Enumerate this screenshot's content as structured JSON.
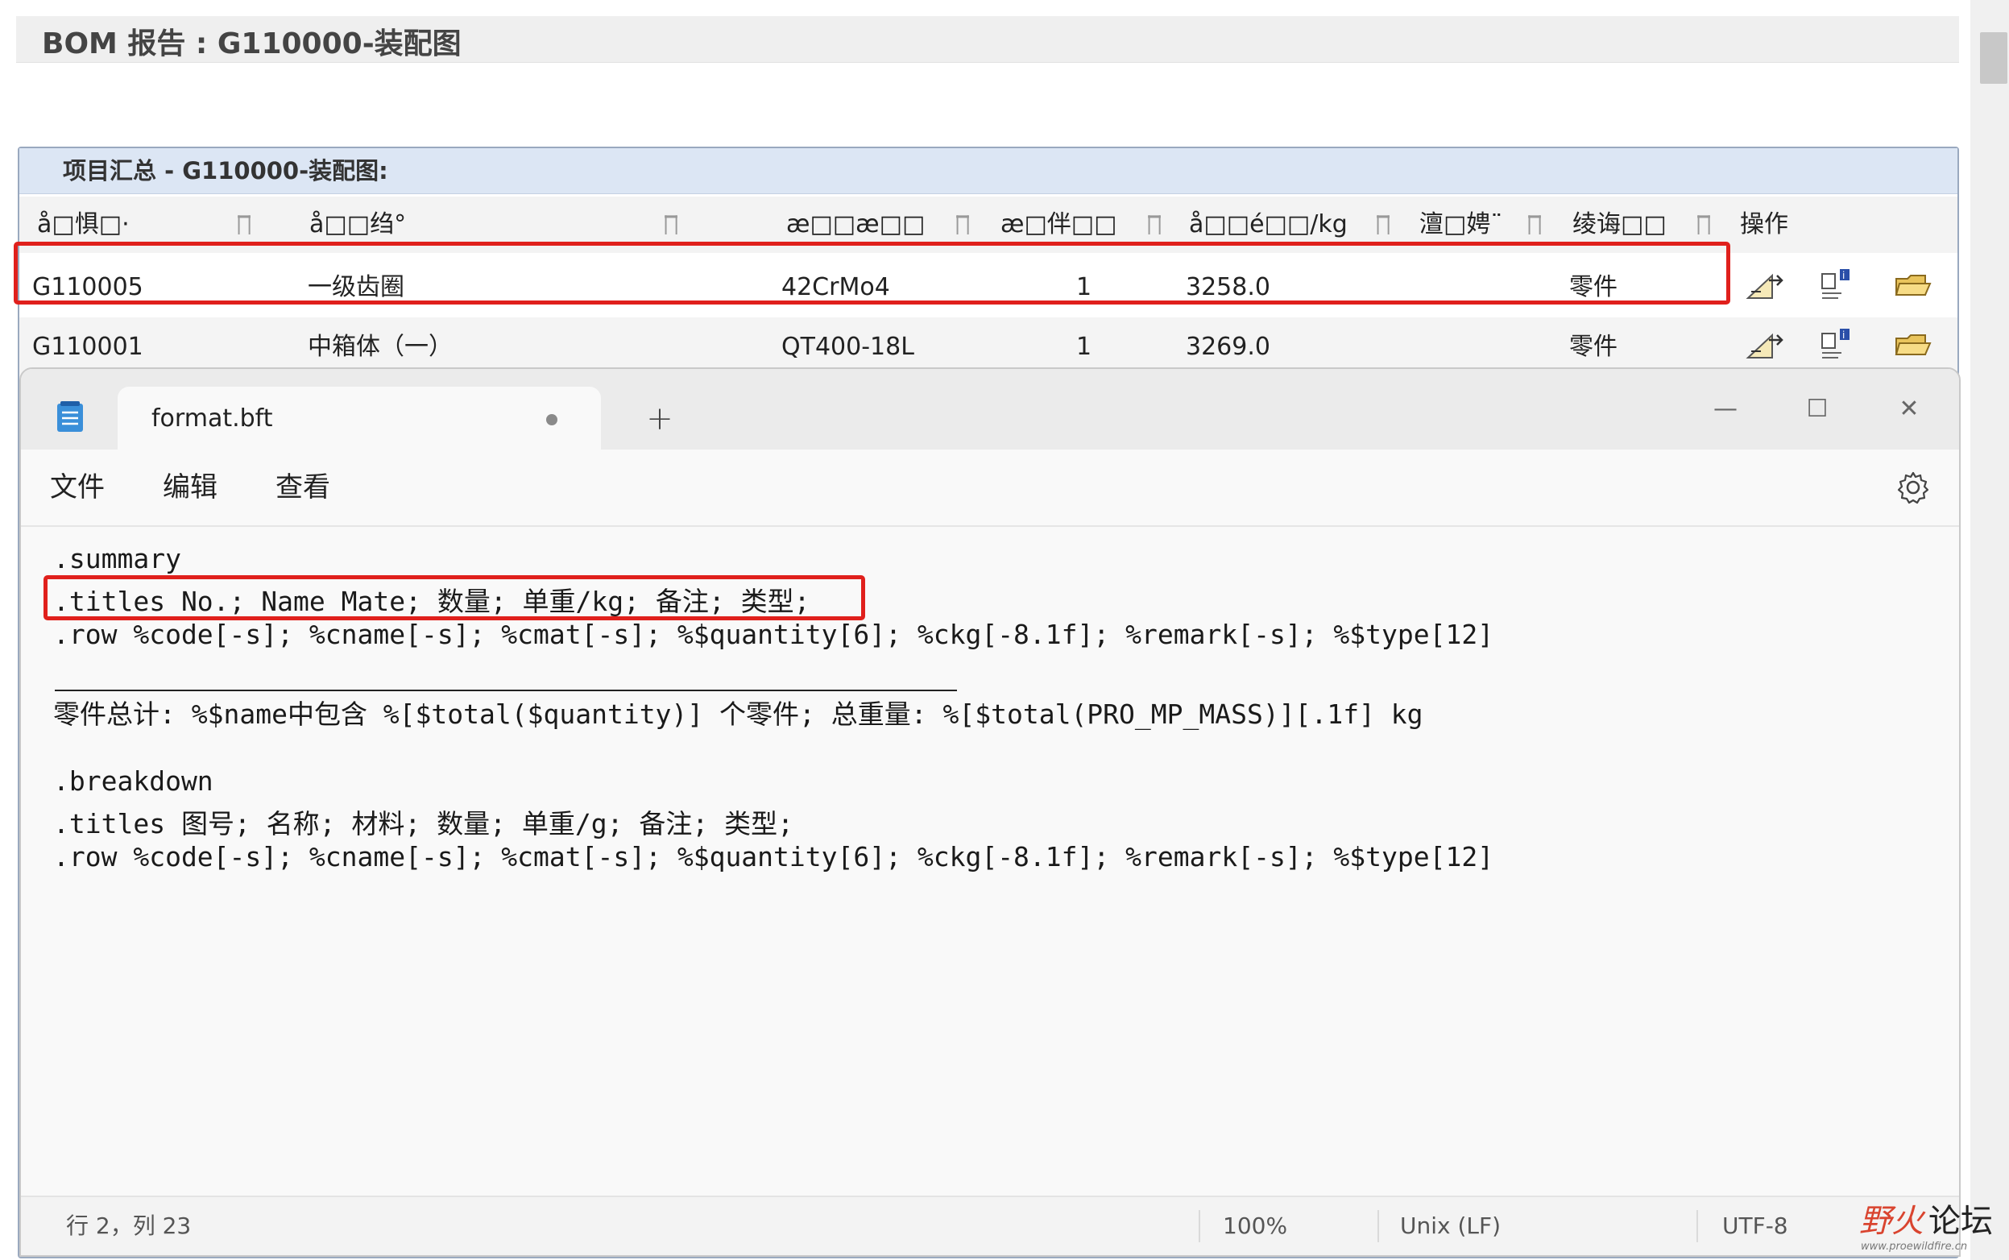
{
  "report": {
    "title": "BOM 报告 : G110000-装配图",
    "summary_title": "项目汇总 - G110000-装配图:",
    "columns": [
      "å□惧□·",
      "å□□绉°",
      "æ□□æ□□",
      "æ□伴□□",
      "å□□é□□/kg",
      "澶□娉¨",
      "绫诲□□",
      "操作"
    ],
    "rows": [
      {
        "code": "G110005",
        "name": "一级齿圈",
        "material": "42CrMo4",
        "qty": "1",
        "weight": "3258.0",
        "type": "零件"
      },
      {
        "code": "G110001",
        "name": "中箱体（一）",
        "material": "QT400-18L",
        "qty": "1",
        "weight": "3269.0",
        "type": "零件"
      }
    ],
    "action_icons": [
      "edit-dimension-icon",
      "info-properties-icon",
      "open-folder-icon"
    ]
  },
  "notepad": {
    "tab_title": "format.bft",
    "new_tab_symbol": "+",
    "window_controls": {
      "minimize": "—",
      "maximize": "☐",
      "close": "✕"
    },
    "menu": [
      "文件",
      "编辑",
      "查看"
    ],
    "lines": [
      ".summary",
      ".titles No.; Name Mate; 数量; 单重/kg; 备注; 类型;",
      ".row %code[-s]; %cname[-s]; %cmat[-s]; %$quantity[6]; %ckg[-8.1f]; %remark[-s]; %$type[12]",
      "零件总计: %$name中包含 %[$total($quantity)] 个零件; 总重量: %[$total(PRO_MP_MASS)][.1f] kg",
      ".breakdown",
      ".titles 图号; 名称; 材料; 数量; 单重/g; 备注; 类型;",
      ".row %code[-s]; %cname[-s]; %cmat[-s]; %$quantity[6]; %ckg[-8.1f]; %remark[-s]; %$type[12]"
    ],
    "status": {
      "position": "行 2，列 23",
      "zoom": "100%",
      "line_ending": "Unix (LF)",
      "encoding": "UTF-8"
    }
  },
  "watermark": {
    "text_red": "野火",
    "text_black": "论坛",
    "url": "www.proewildfire.cn"
  },
  "colors": {
    "highlight": "#e0201c",
    "summary_bar": "#dce6f4",
    "watermark_red": "#d9442f"
  }
}
